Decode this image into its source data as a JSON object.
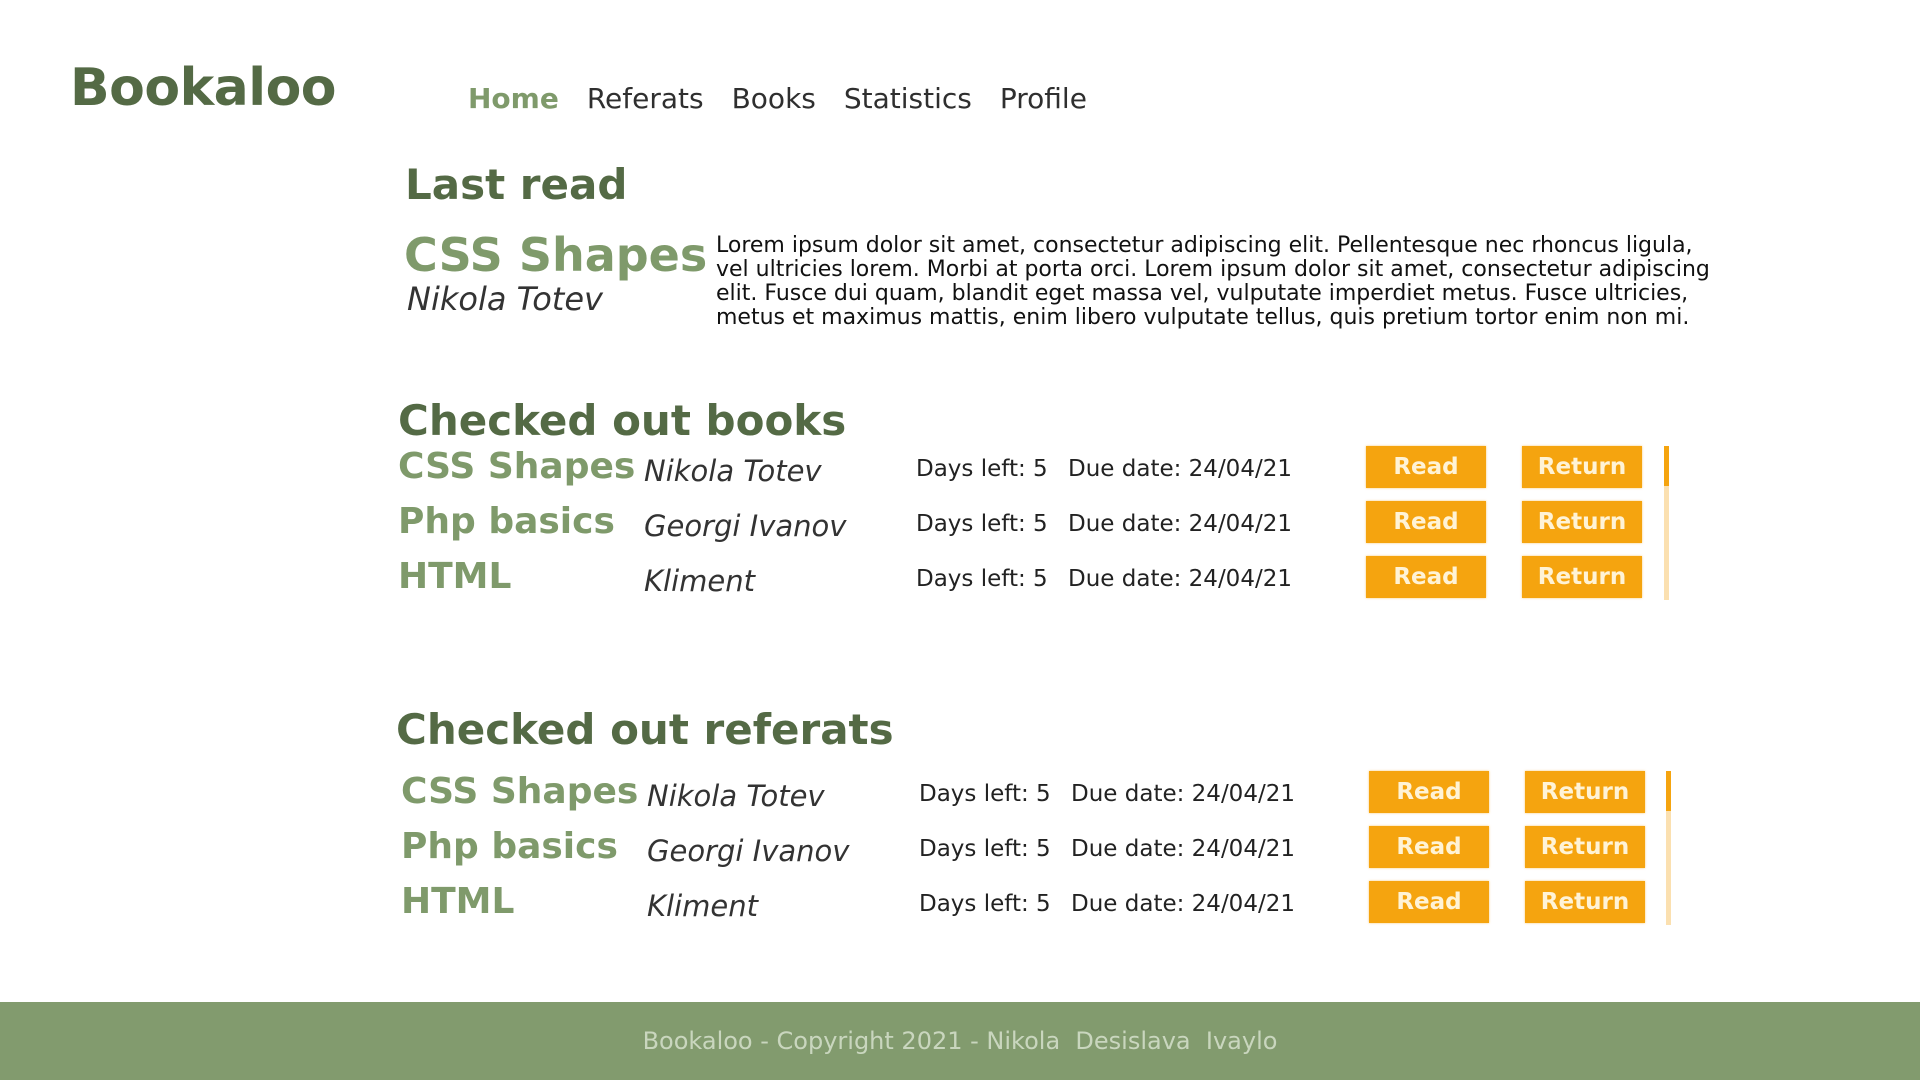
{
  "brand": "Bookaloo",
  "nav": [
    {
      "label": "Home",
      "active": true
    },
    {
      "label": "Referats",
      "active": false
    },
    {
      "label": "Books",
      "active": false
    },
    {
      "label": "Statistics",
      "active": false
    },
    {
      "label": "Profile",
      "active": false
    }
  ],
  "last_read": {
    "heading": "Last read",
    "title": "CSS Shapes",
    "author": "Nikola Totev",
    "description": "Lorem ipsum dolor sit amet, consectetur adipiscing elit. Pellentesque nec rhoncus ligula, vel ultricies lorem. Morbi at porta orci. Lorem ipsum dolor sit amet, consectetur adipiscing elit. Fusce dui quam, blandit eget massa vel, vulputate imperdiet metus. Fusce ultricies, metus et maximus mattis, enim libero vulputate tellus, quis pretium tortor enim non mi."
  },
  "books": {
    "heading": "Checked out books",
    "items": [
      {
        "title": "CSS Shapes",
        "author": "Nikola Totev",
        "days": "Days left: 5",
        "due": "Due date: 24/04/21",
        "read": "Read",
        "return": "Return"
      },
      {
        "title": "Php basics",
        "author": "Georgi Ivanov",
        "days": "Days left: 5",
        "due": "Due date: 24/04/21",
        "read": "Read",
        "return": "Return"
      },
      {
        "title": "HTML",
        "author": "Kliment",
        "days": "Days left: 5",
        "due": "Due date: 24/04/21",
        "read": "Read",
        "return": "Return"
      }
    ]
  },
  "referats": {
    "heading": "Checked out referats",
    "items": [
      {
        "title": "CSS Shapes",
        "author": "Nikola Totev",
        "days": "Days left: 5",
        "due": "Due date: 24/04/21",
        "read": "Read",
        "return": "Return"
      },
      {
        "title": "Php basics",
        "author": "Georgi Ivanov",
        "days": "Days left: 5",
        "due": "Due date: 24/04/21",
        "read": "Read",
        "return": "Return"
      },
      {
        "title": "HTML",
        "author": "Kliment",
        "days": "Days left: 5",
        "due": "Due date: 24/04/21",
        "read": "Read",
        "return": "Return"
      }
    ]
  },
  "footer": "Bookaloo - Copyright 2021 - Nikola  Desislava  Ivaylo",
  "colors": {
    "brand_dark": "#546a45",
    "brand_light": "#7f9a6b",
    "button": "#f5a40f",
    "footer_bg": "#829b6e"
  }
}
